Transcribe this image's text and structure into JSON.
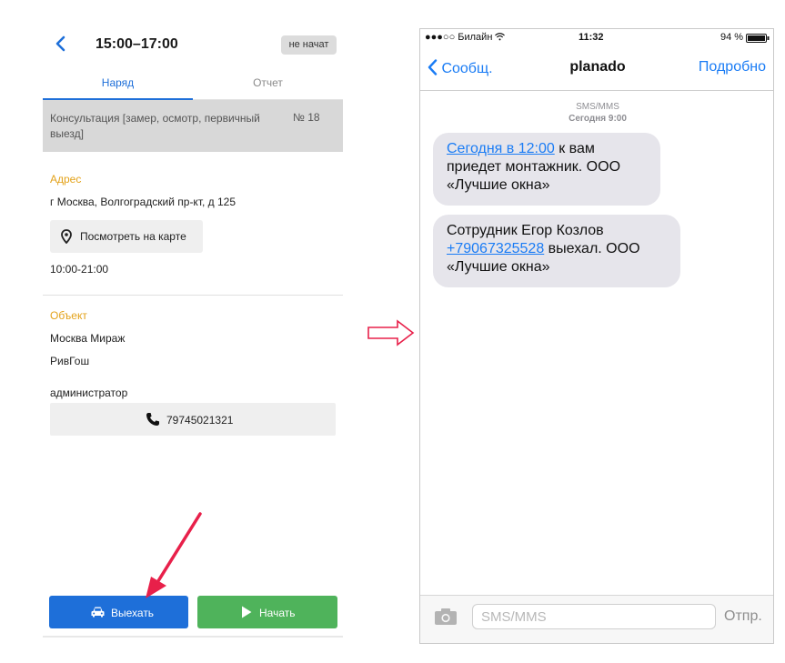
{
  "left": {
    "title": "15:00–17:00",
    "status": "не начат",
    "tabs": [
      "Наряд",
      "Отчет"
    ],
    "order": {
      "text": "Консультация [замер, осмотр, первичный выезд]",
      "number": "№ 18"
    },
    "address": {
      "label": "Адрес",
      "value": "г Москва, Волгоградский пр-кт, д 125",
      "map_button": "Посмотреть на карте",
      "hours": "10:00-21:00"
    },
    "object": {
      "label": "Объект",
      "name": "Москва Мираж",
      "line2": "РивГош",
      "role": "администратор",
      "phone": "79745021321"
    },
    "buttons": {
      "go": "Выехать",
      "start": "Начать"
    }
  },
  "phone": {
    "status_bar": {
      "carrier": "●●●○○ Билайн",
      "time": "11:32",
      "battery": "94 %"
    },
    "nav": {
      "back": "Сообщ.",
      "title": "planado",
      "detail": "Подробно"
    },
    "meta": {
      "type": "SMS/MMS",
      "date": "Сегодня 9:00"
    },
    "messages": [
      {
        "link": "Сегодня в 12:00",
        "rest": " к вам приедет монтажник. ООО «Лучшие окна»"
      },
      {
        "prefix": "Сотрудник Егор Козлов ",
        "link": "+79067325528",
        "rest": " выехал. ООО «Лучшие окна»"
      }
    ],
    "input": {
      "placeholder": "SMS/MMS",
      "send": "Отпр."
    }
  },
  "colors": {
    "primary_blue": "#1e6fd9",
    "green": "#4fb35b",
    "accent_orange": "#e3a21a",
    "ios_blue": "#1a7cf5",
    "arrow_red": "#e8204a"
  }
}
